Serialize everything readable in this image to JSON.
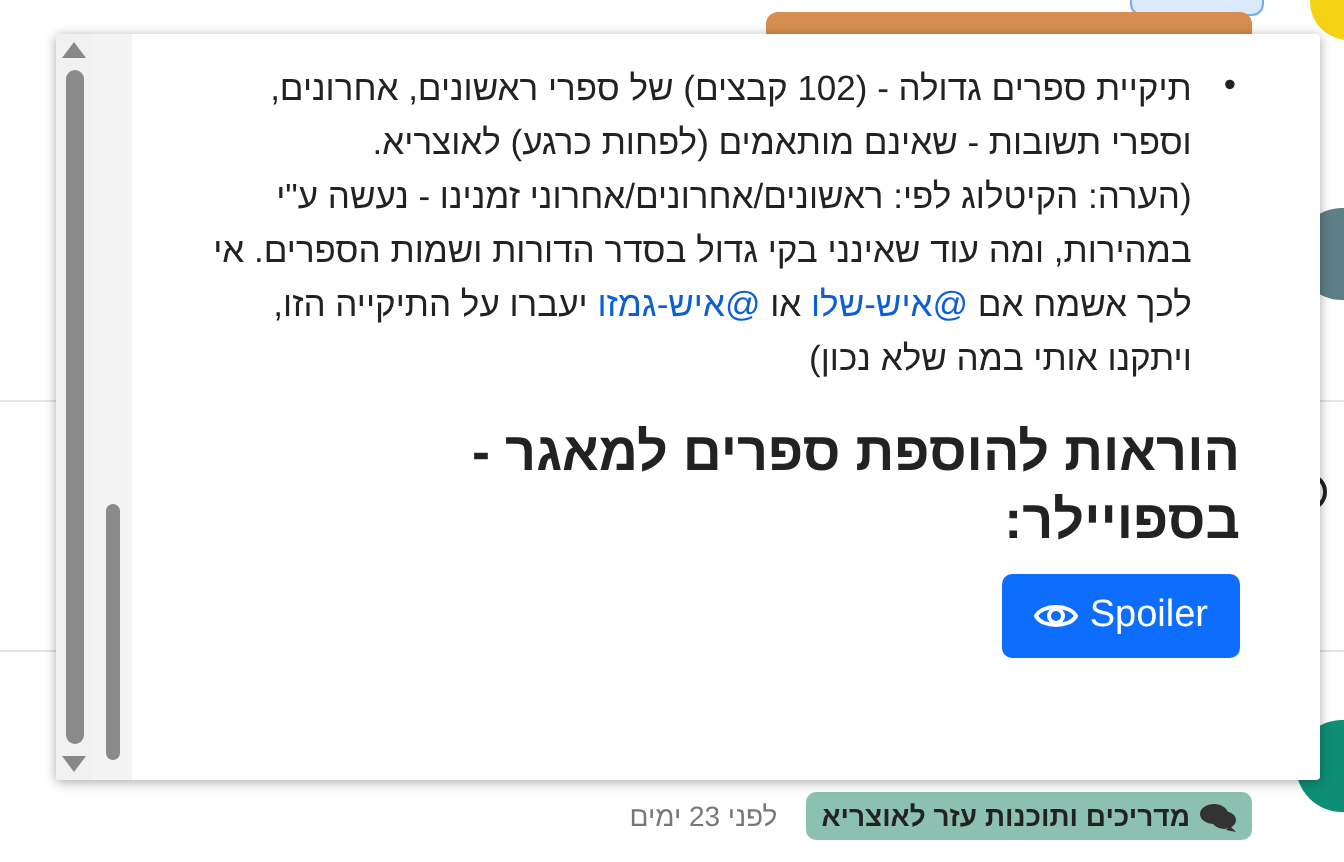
{
  "background": {
    "topic_row": {
      "category": "מדריכים ותוכנות עזר לאוצריא",
      "time": "לפני 23 ימים"
    }
  },
  "popup": {
    "bullet_marker": "•",
    "bullet_parts": [
      {
        "kind": "text",
        "text": "תיקיית ספרים גדולה - (102 קבצים) של ספרי ראשונים, אחרונים, וספרי תשובות - שאינם מותאמים (לפחות כרגע) לאוצריא.\n(הערה: הקיטלוג לפי: ראשונים/אחרונים/אחרוני זמנינו - נעשה ע\"י במהירות, ומה עוד שאינני בקי גדול בסדר הדורות ושמות הספרים. אי לכך אשמח אם "
      },
      {
        "kind": "link",
        "text": "@איש-שלו"
      },
      {
        "kind": "text",
        "text": " או "
      },
      {
        "kind": "link",
        "text": "@איש-גמזו"
      },
      {
        "kind": "text",
        "text": " יעברו על התיקייה הזו, ויתקנו אותי במה שלא נכון)"
      }
    ],
    "heading": "הוראות להוספת ספרים למאגר - בספויילר:",
    "spoiler_button": "Spoiler"
  }
}
